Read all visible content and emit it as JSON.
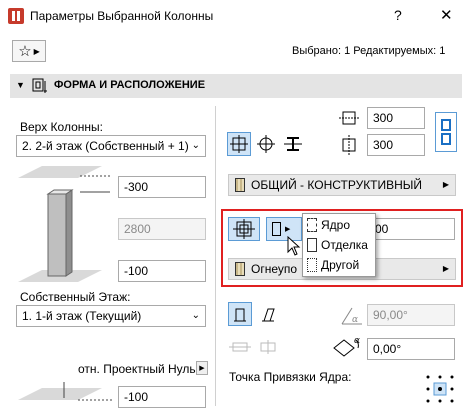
{
  "window": {
    "title": "Параметры Выбранной Колонны",
    "help_label": "?",
    "close_label": "✕"
  },
  "toolbar": {
    "selection_status": "Выбрано: 1 Редактируемых: 1"
  },
  "section": {
    "title": "ФОРМА И РАСПОЛОЖЕНИЕ"
  },
  "left": {
    "top_label": "Верх Колонны:",
    "top_select_value": "2. 2-й этаж (Собственный + 1)",
    "top_offset": "-300",
    "height": "2800",
    "bottom_offset": "-100",
    "home_story_label": "Собственный Этаж:",
    "home_story_value": "1. 1-й этаж (Текущий)",
    "ref_label": "отн. Проектный Нуль",
    "ref_value": "-100"
  },
  "right": {
    "width_value": "300",
    "depth_value": "300",
    "material1_label": "ОБЩИЙ - КОНСТРУКТИВНЫЙ",
    "veneer_value": "00",
    "material2_label": "Огнеупо",
    "slant_angle": "90,00°",
    "rotation_angle": "0,00°",
    "anchor_label": "Точка Привязки Ядра:"
  },
  "popup_menu": {
    "items": [
      {
        "label": "Ядро"
      },
      {
        "label": "Отделка"
      },
      {
        "label": "Другой"
      }
    ]
  }
}
